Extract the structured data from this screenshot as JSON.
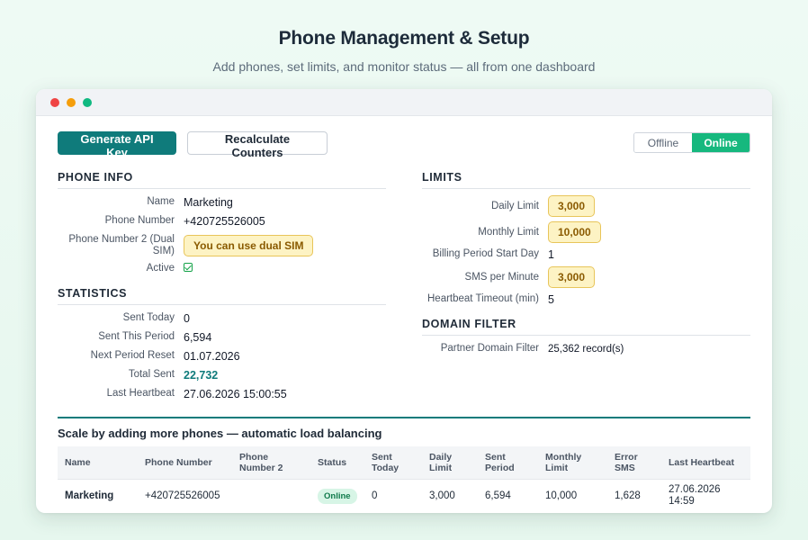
{
  "hero": {
    "title": "Phone Management & Setup",
    "subtitle": "Add phones, set limits, and monitor status — all from one dashboard"
  },
  "toolbar": {
    "generate_label": "Generate API Key",
    "recalculate_label": "Recalculate Counters",
    "status_toggle": {
      "offline": "Offline",
      "online": "Online",
      "selected": "Online"
    }
  },
  "phone_info": {
    "title": "PHONE INFO",
    "name_label": "Name",
    "name_value": "Marketing",
    "phone_label": "Phone Number",
    "phone_value": "+420725526005",
    "phone2_label": "Phone Number 2 (Dual SIM)",
    "phone2_badge": "You can use dual SIM",
    "active_label": "Active"
  },
  "statistics": {
    "title": "STATISTICS",
    "sent_today_label": "Sent Today",
    "sent_today_value": "0",
    "sent_period_label": "Sent This Period",
    "sent_period_value": "6,594",
    "next_reset_label": "Next Period Reset",
    "next_reset_value": "01.07.2026",
    "total_sent_label": "Total Sent",
    "total_sent_value": "22,732",
    "last_hb_label": "Last Heartbeat",
    "last_hb_value": "27.06.2026 15:00:55"
  },
  "limits": {
    "title": "LIMITS",
    "daily_label": "Daily Limit",
    "daily_value": "3,000",
    "monthly_label": "Monthly Limit",
    "monthly_value": "10,000",
    "billing_label": "Billing Period Start Day",
    "billing_value": "1",
    "spm_label": "SMS per Minute",
    "spm_value": "3,000",
    "hb_timeout_label": "Heartbeat Timeout (min)",
    "hb_timeout_value": "5"
  },
  "domain_filter": {
    "title": "DOMAIN FILTER",
    "partner_label": "Partner Domain Filter",
    "partner_value": "25,362 record(s)"
  },
  "scale": {
    "title": "Scale by adding more phones — automatic load balancing",
    "headers": [
      "Name",
      "Phone Number",
      "Phone Number 2",
      "Status",
      "Sent Today",
      "Daily Limit",
      "Sent Period",
      "Monthly Limit",
      "Error SMS",
      "Last Heartbeat"
    ],
    "rows": [
      [
        "Marketing",
        "+420725526005",
        "",
        "Online",
        "0",
        "3,000",
        "6,594",
        "10,000",
        "1,628",
        "27.06.2026 14:59"
      ]
    ]
  },
  "colors": {
    "primary": "#0f7b7b",
    "online": "#16b87e",
    "badge_bg": "#fdf3c4",
    "badge_border": "#e8c55a"
  }
}
